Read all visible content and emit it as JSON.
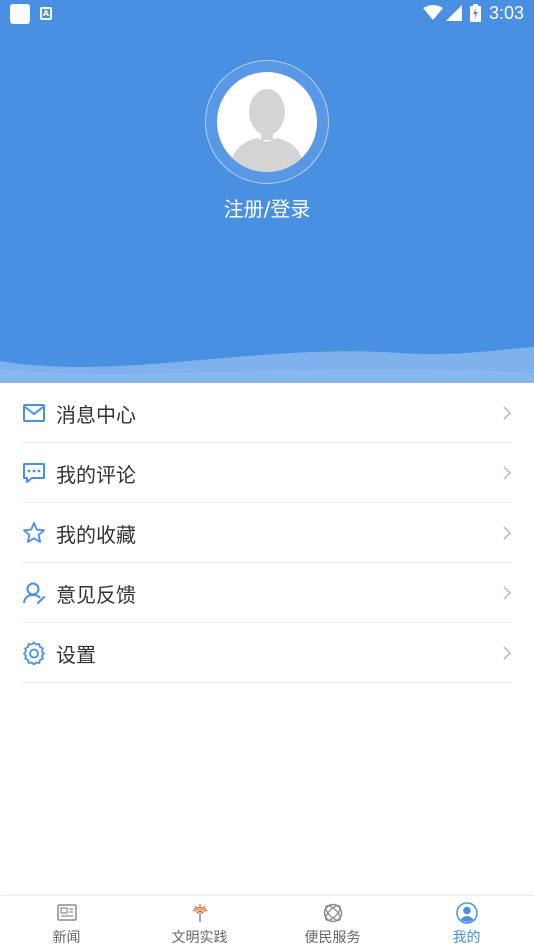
{
  "status_bar": {
    "time": "3:03",
    "icons": [
      "app-notification-icon",
      "a-notification-icon",
      "wifi-icon",
      "signal-icon",
      "battery-icon"
    ]
  },
  "profile": {
    "login_label": "注册/登录",
    "avatar_icon": "default-avatar-icon"
  },
  "menu": {
    "items": [
      {
        "label": "消息中心",
        "icon": "mail-icon"
      },
      {
        "label": "我的评论",
        "icon": "comment-icon"
      },
      {
        "label": "我的收藏",
        "icon": "star-icon"
      },
      {
        "label": "意见反馈",
        "icon": "user-feedback-icon"
      },
      {
        "label": "设置",
        "icon": "gear-icon"
      }
    ]
  },
  "tabbar": {
    "tabs": [
      {
        "label": "新闻",
        "icon": "newspaper-icon",
        "active": false
      },
      {
        "label": "文明实践",
        "icon": "torch-icon",
        "active": false
      },
      {
        "label": "便民服务",
        "icon": "orbit-icon",
        "active": false
      },
      {
        "label": "我的",
        "icon": "profile-icon",
        "active": true
      }
    ]
  },
  "colors": {
    "header_blue": "#4a90e2",
    "accent": "#4a90e2",
    "menu_icon": "#4a90e2",
    "text": "#333333",
    "tab_inactive": "#666666"
  }
}
